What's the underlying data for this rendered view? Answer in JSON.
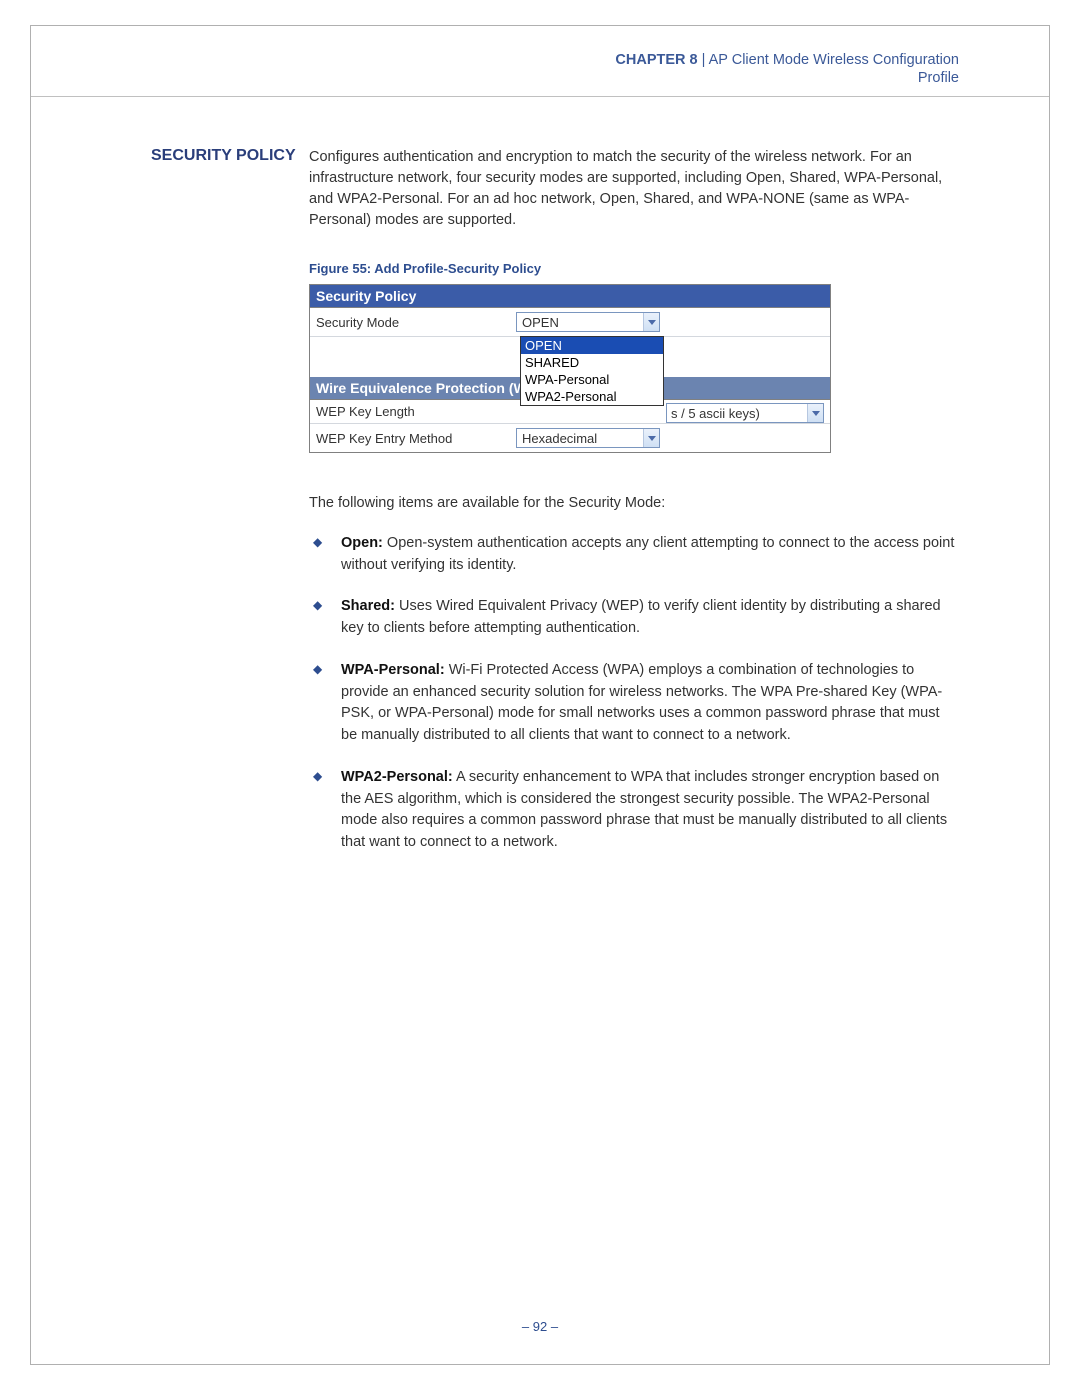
{
  "header": {
    "chapter_label": "CHAPTER 8",
    "separator": "  |  ",
    "chapter_title": "AP Client Mode Wireless Configuration",
    "subline": "Profile"
  },
  "side_heading": "SECURITY POLICY",
  "intro_paragraph": "Configures authentication and encryption to match the security of the wireless network. For an infrastructure network, four security modes are supported, including Open, Shared, WPA-Personal, and WPA2-Personal. For an ad hoc network, Open, Shared, and WPA-NONE (same as WPA-Personal) modes are supported.",
  "figure_caption": "Figure 55:  Add Profile-Security Policy",
  "panel": {
    "section1_title": "Security Policy",
    "security_mode_label": "Security Mode",
    "security_mode_value": "OPEN",
    "dropdown_options": [
      "OPEN",
      "SHARED",
      "WPA-Personal",
      "WPA2-Personal"
    ],
    "section2_title": "Wire Equivalence Protection (WEP)",
    "wep_key_length_label": "WEP Key Length",
    "wep_key_length_trailing": "s / 5 ascii keys)",
    "wep_entry_label": "WEP Key Entry Method",
    "wep_entry_value": "Hexadecimal"
  },
  "after_figure_intro": "The following items are available for the Security Mode:",
  "bullets": [
    {
      "title": "Open:",
      "text": " Open-system authentication accepts any client attempting to connect to the access point without verifying its identity."
    },
    {
      "title": "Shared:",
      "text": " Uses Wired Equivalent Privacy (WEP) to verify client identity by distributing a shared key to clients before attempting authentication."
    },
    {
      "title": "WPA-Personal:",
      "text": " Wi-Fi Protected Access (WPA) employs a combination of technologies to provide an enhanced security solution for wireless networks. The WPA Pre-shared Key (WPA-PSK, or WPA-Personal) mode for small networks uses a common password phrase that must be manually distributed to all clients that want to connect to a network."
    },
    {
      "title": "WPA2-Personal:",
      "text": " A security enhancement to WPA that includes stronger encryption based on the AES algorithm, which is considered the strongest security possible. The WPA2-Personal mode also requires a common password phrase that must be manually distributed to all clients that want to connect to a network."
    }
  ],
  "footer_page": "–  92  –"
}
